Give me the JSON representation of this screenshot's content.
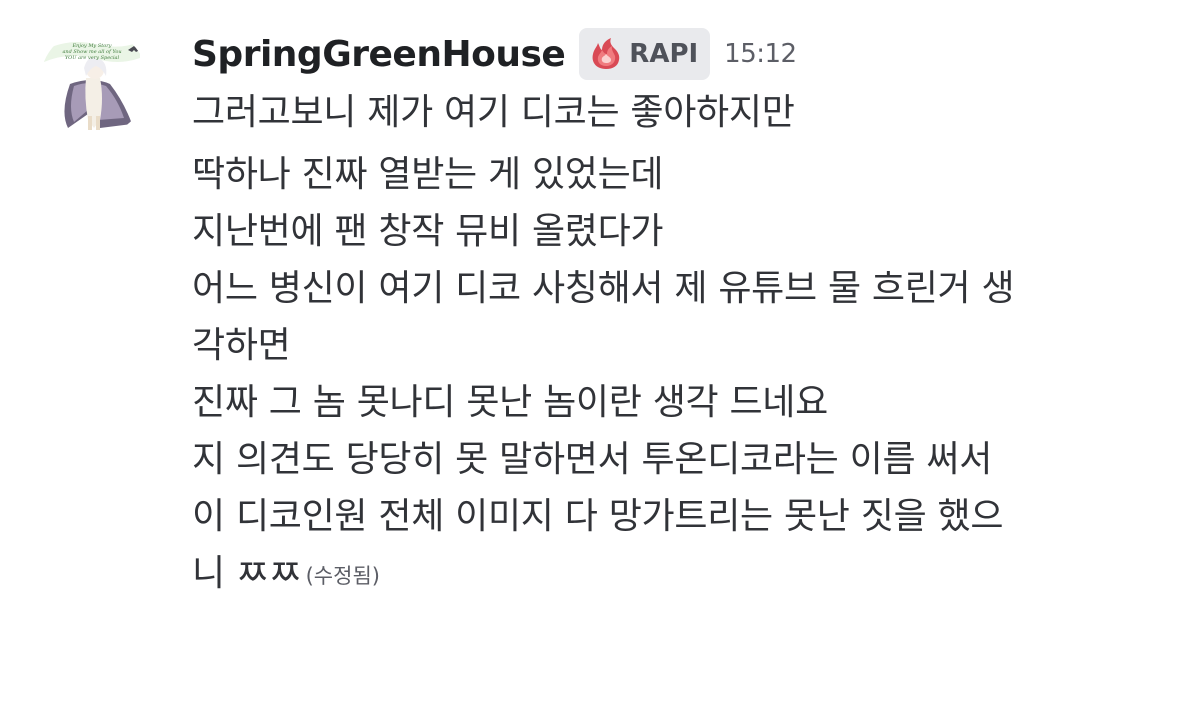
{
  "message": {
    "author": "SpringGreenHouse",
    "tag": {
      "label": "RAPI",
      "icon": "flame-icon"
    },
    "timestamp": "15:12",
    "lines": [
      "그러고보니 제가 여기 디코는 좋아하지만",
      "딱하나 진짜 열받는 게 있었는데",
      "지난번에 팬 창작 뮤비 올렸다가",
      "어느 병신이 여기 디코 사칭해서 제 유튜브 물 흐린거 생",
      "각하면",
      "진짜 그 놈 못나디 못난 놈이란 생각 드네요",
      "지 의견도 당당히 못 말하면서 투온디코라는 이름 써서",
      "이 디코인원 전체 이미지 다 망가트리는 못난 짓을 했으",
      "니 ㅉㅉ"
    ],
    "edited_label": "(수정됨)"
  },
  "avatar": {
    "icon": "user-avatar-icon",
    "caption_lines": [
      "Enjoy My Story",
      "and Show me all of You",
      "YOU are very Special"
    ]
  },
  "colors": {
    "text": "#313338",
    "username": "#1f2124",
    "tag_bg": "#e9eaed",
    "muted": "#5c5e66",
    "flame": "#e25a63"
  }
}
